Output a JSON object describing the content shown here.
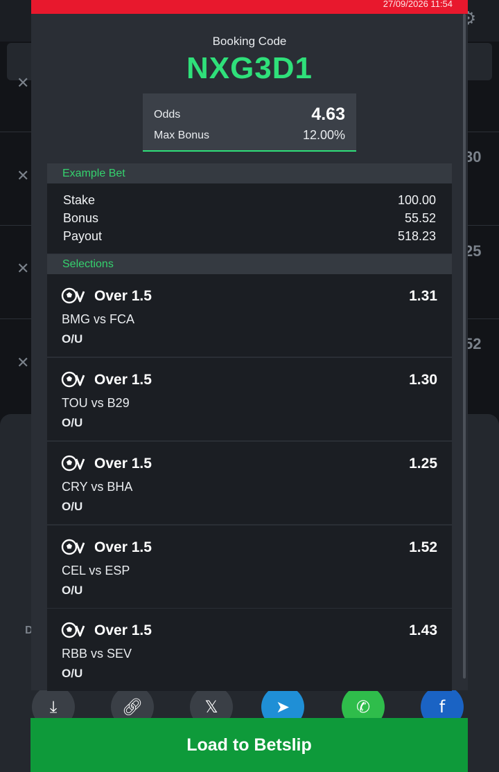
{
  "header": {
    "timestamp": "27/09/2026 11:54"
  },
  "booking": {
    "label": "Booking Code",
    "code": "NXG3D1"
  },
  "odds_summary": {
    "odds_label": "Odds",
    "odds_value": "4.63",
    "bonus_label": "Max Bonus",
    "bonus_value": "12.00%"
  },
  "example_bet": {
    "title": "Example Bet",
    "rows": [
      {
        "label": "Stake",
        "value": "100.00"
      },
      {
        "label": "Bonus",
        "value": "55.52"
      },
      {
        "label": "Payout",
        "value": "518.23"
      }
    ]
  },
  "selections": {
    "title": "Selections",
    "items": [
      {
        "market": "Over 1.5",
        "odds": "1.31",
        "match": "BMG vs FCA",
        "type": "O/U",
        "icon": "soccer-virtual-icon"
      },
      {
        "market": "Over 1.5",
        "odds": "1.30",
        "match": "TOU vs B29",
        "type": "O/U",
        "icon": "soccer-virtual-icon"
      },
      {
        "market": "Over 1.5",
        "odds": "1.25",
        "match": "CRY vs BHA",
        "type": "O/U",
        "icon": "soccer-virtual-icon"
      },
      {
        "market": "Over 1.5",
        "odds": "1.52",
        "match": "CEL vs ESP",
        "type": "O/U",
        "icon": "soccer-virtual-icon"
      },
      {
        "market": "Over 1.5",
        "odds": "1.43",
        "match": "RBB vs SEV",
        "type": "O/U",
        "icon": "soccer-virtual-icon"
      }
    ]
  },
  "background": {
    "partial_numbers": [
      "30",
      "25",
      "52"
    ],
    "partial_letter": "D"
  },
  "actions": {
    "load_label": "Load to Betslip"
  },
  "colors": {
    "accent_green": "#2fe07a",
    "header_red": "#e8182d",
    "button_green": "#0e9a3a"
  }
}
